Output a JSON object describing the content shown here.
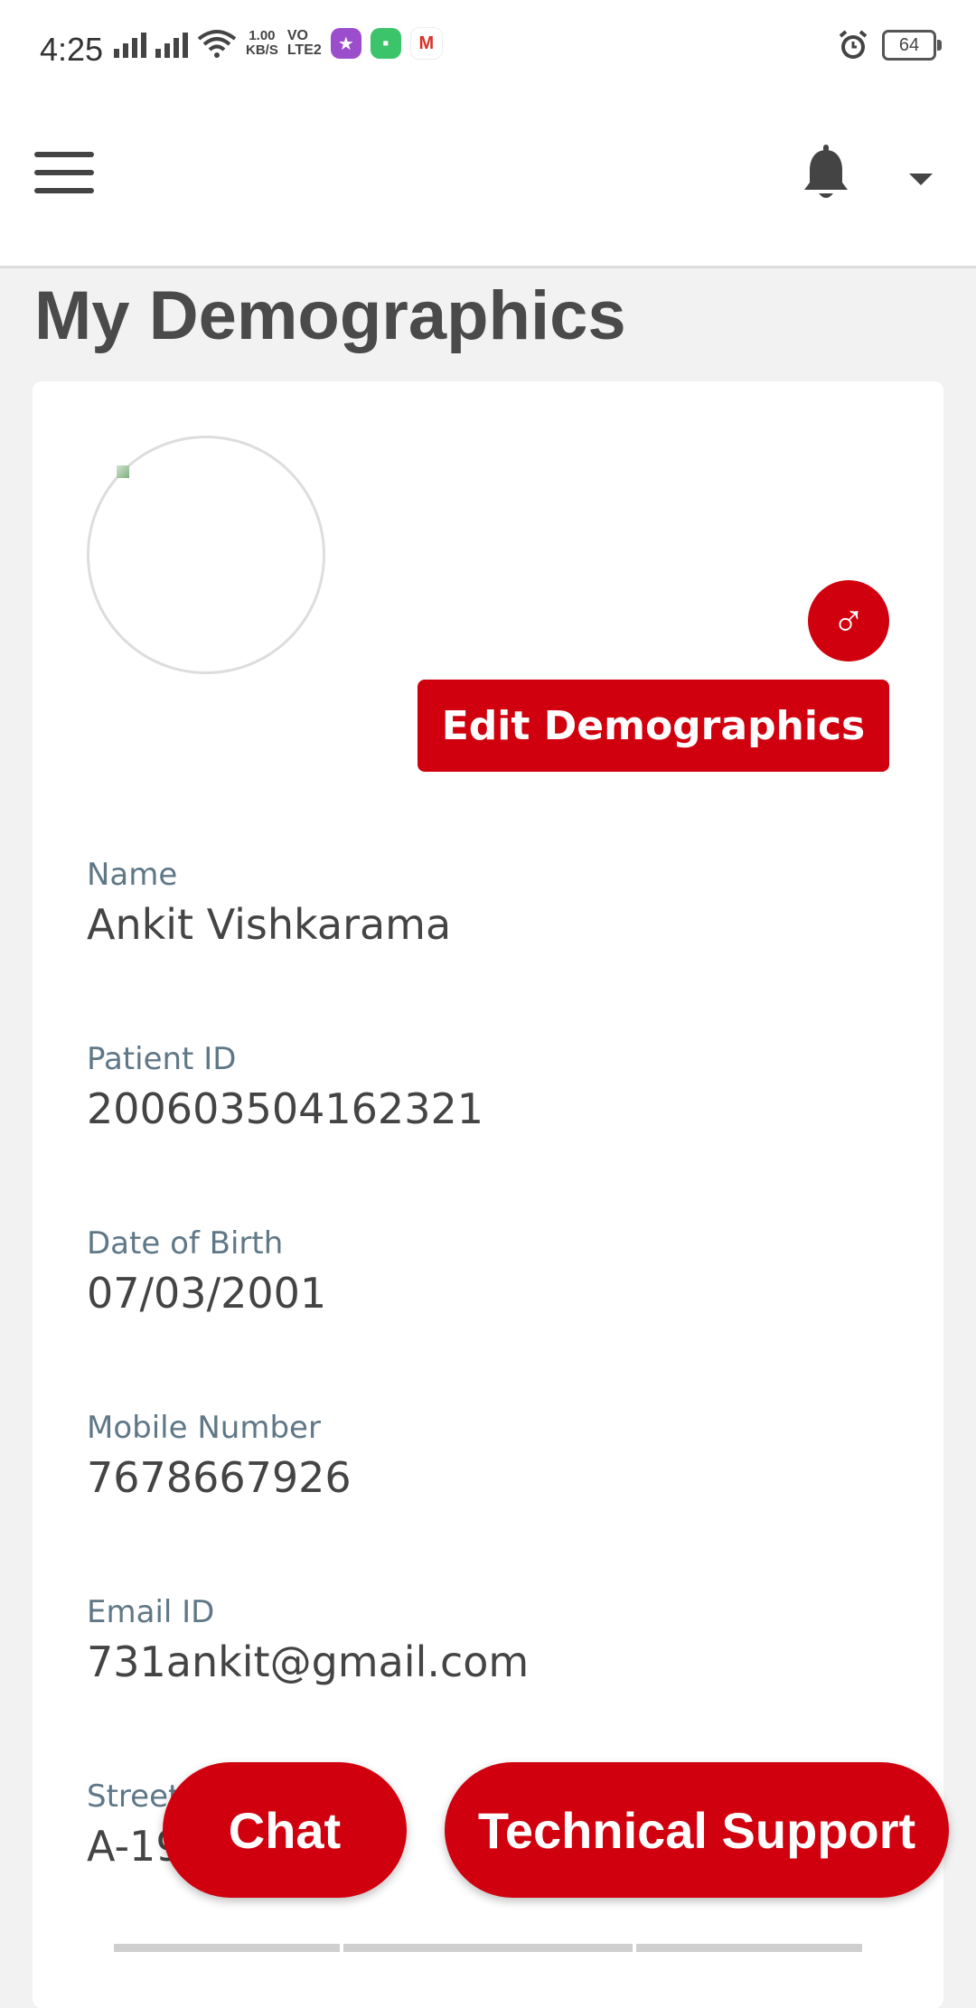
{
  "status_bar": {
    "time": "4:25",
    "speed_value": "1.00",
    "speed_unit": "KB/S",
    "volte_top": "VO",
    "volte_bottom": "LTE2",
    "battery": "64"
  },
  "header": {
    "menu_icon": "hamburger-menu-icon",
    "notification_icon": "bell-icon",
    "dropdown_icon": "caret-down-icon"
  },
  "page": {
    "title": "My Demographics"
  },
  "profile": {
    "gender_symbol": "♂",
    "edit_button": "Edit Demographics"
  },
  "fields": [
    {
      "label": "Name",
      "value": "Ankit Vishkarama"
    },
    {
      "label": "Patient ID",
      "value": "200603504162321"
    },
    {
      "label": "Date of Birth",
      "value": "07/03/2001"
    },
    {
      "label": "Mobile Number",
      "value": "7678667926"
    },
    {
      "label": "Email ID",
      "value": "731ankit@gmail.com"
    },
    {
      "label": "Street",
      "value": "A-19"
    }
  ],
  "floating": {
    "chat": "Chat",
    "support": "Technical Support"
  },
  "colors": {
    "accent": "#d1000e",
    "label": "#5f7787",
    "text": "#444444"
  }
}
